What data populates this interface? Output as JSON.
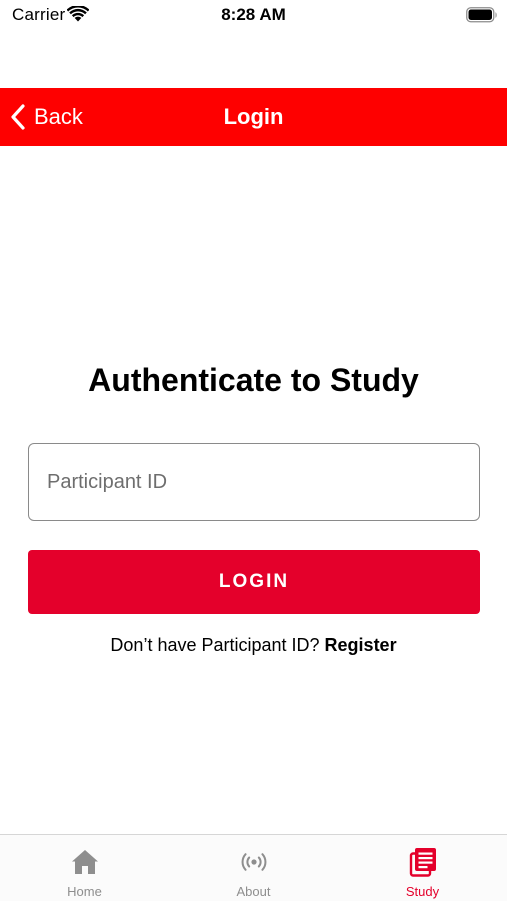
{
  "status_bar": {
    "carrier": "Carrier",
    "time": "8:28 AM"
  },
  "navbar": {
    "back_label": "Back",
    "title": "Login",
    "background_color": "#fe0000"
  },
  "main": {
    "heading": "Authenticate to Study",
    "participant_input": {
      "placeholder": "Participant ID",
      "value": ""
    },
    "login_button_label": "LOGIN",
    "login_button_color": "#e4002b",
    "register_prompt": "Don’t have Participant ID?",
    "register_link": "Register"
  },
  "tabbar": {
    "tabs": [
      {
        "label": "Home",
        "icon": "home-icon",
        "active": false
      },
      {
        "label": "About",
        "icon": "broadcast-icon",
        "active": false
      },
      {
        "label": "Study",
        "icon": "study-document-icon",
        "active": true
      }
    ],
    "active_color": "#e4002b",
    "inactive_color": "#8e8e8e"
  }
}
